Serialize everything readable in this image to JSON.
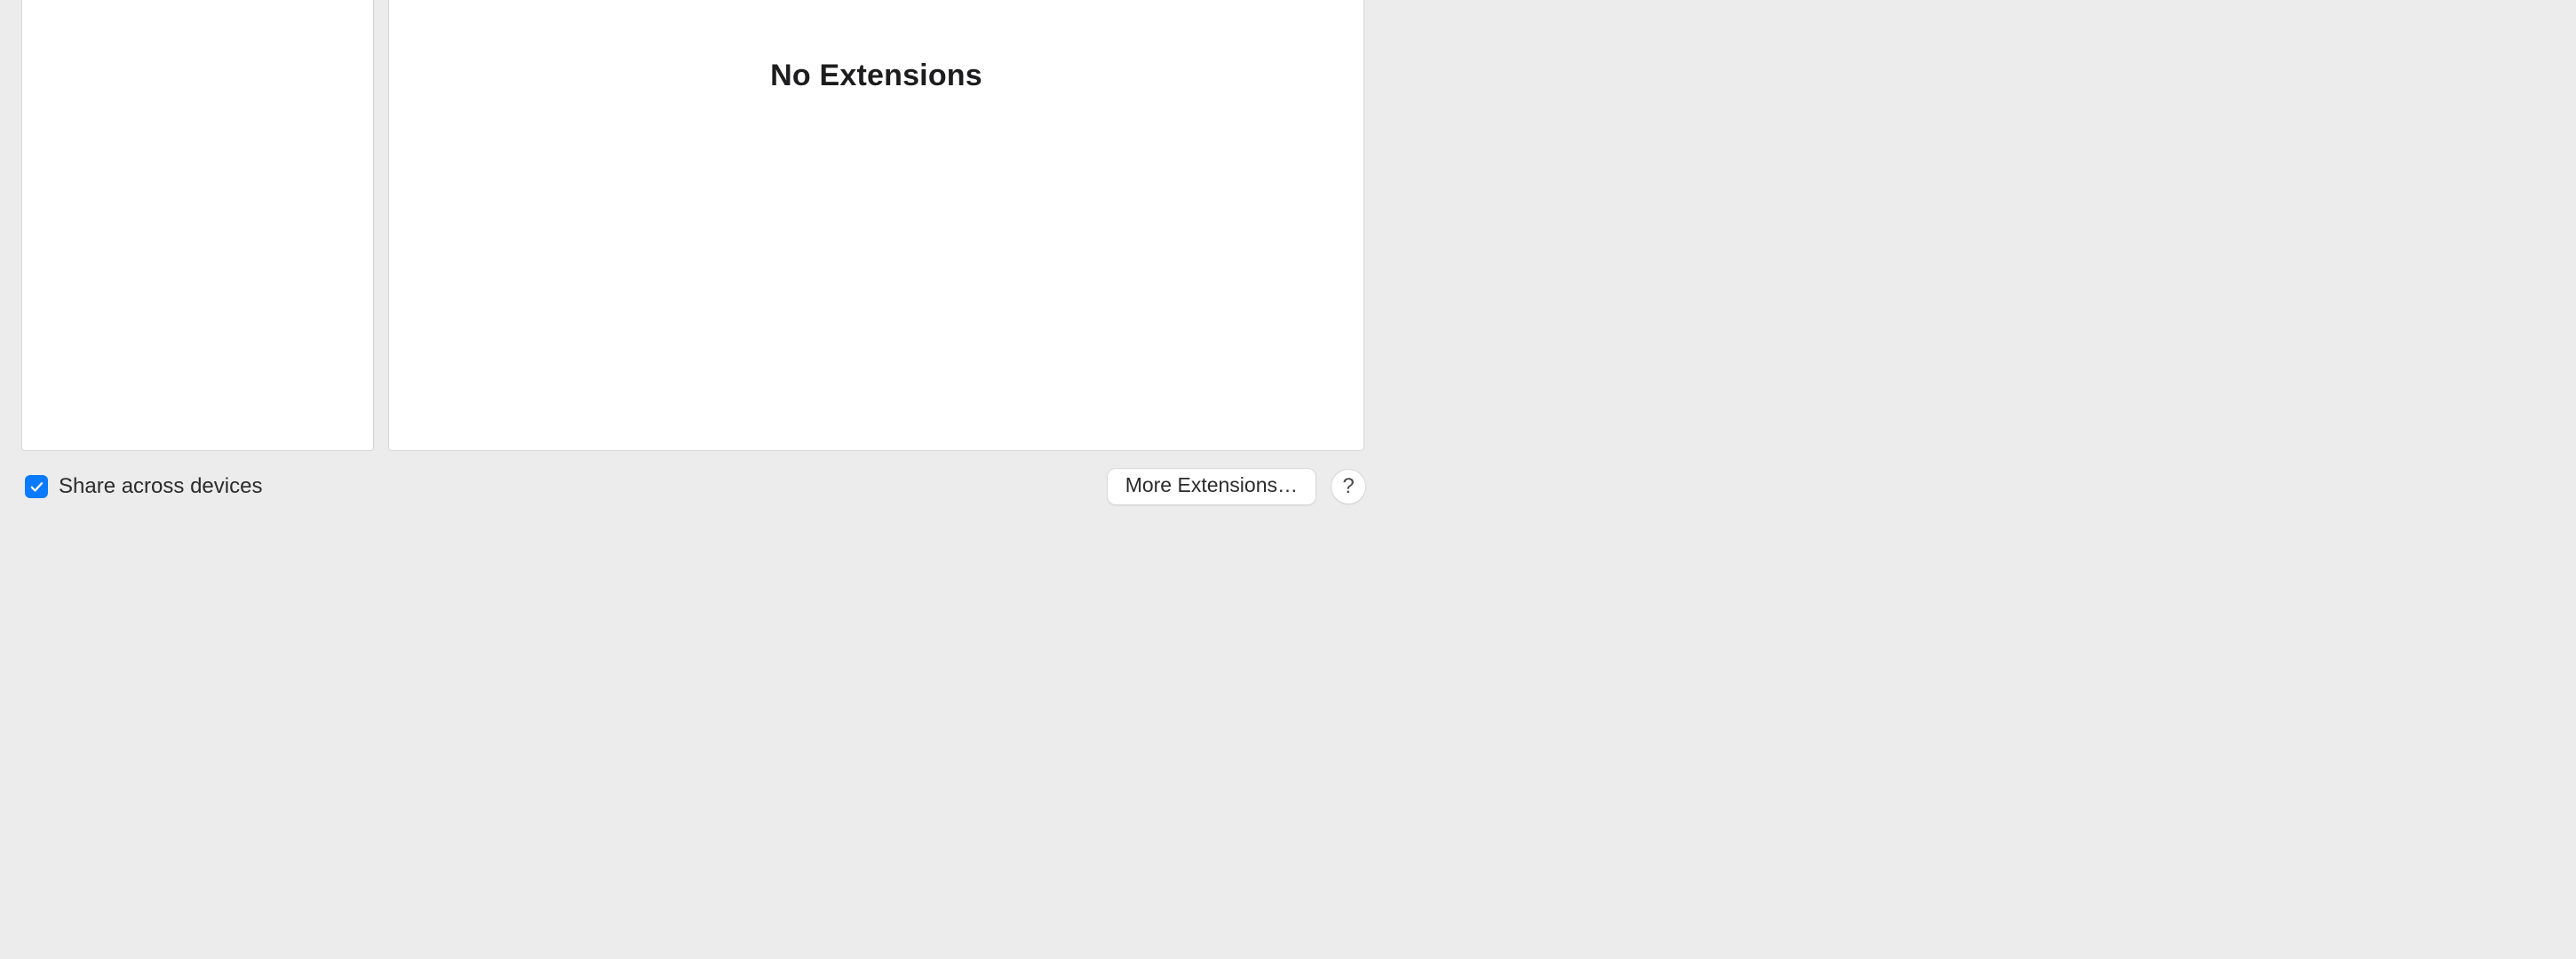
{
  "main": {
    "empty_state_heading": "No Extensions"
  },
  "footer": {
    "share_checkbox": {
      "label": "Share across devices",
      "checked": true
    },
    "more_button_label": "More Extensions…",
    "help_button_label": "?"
  }
}
